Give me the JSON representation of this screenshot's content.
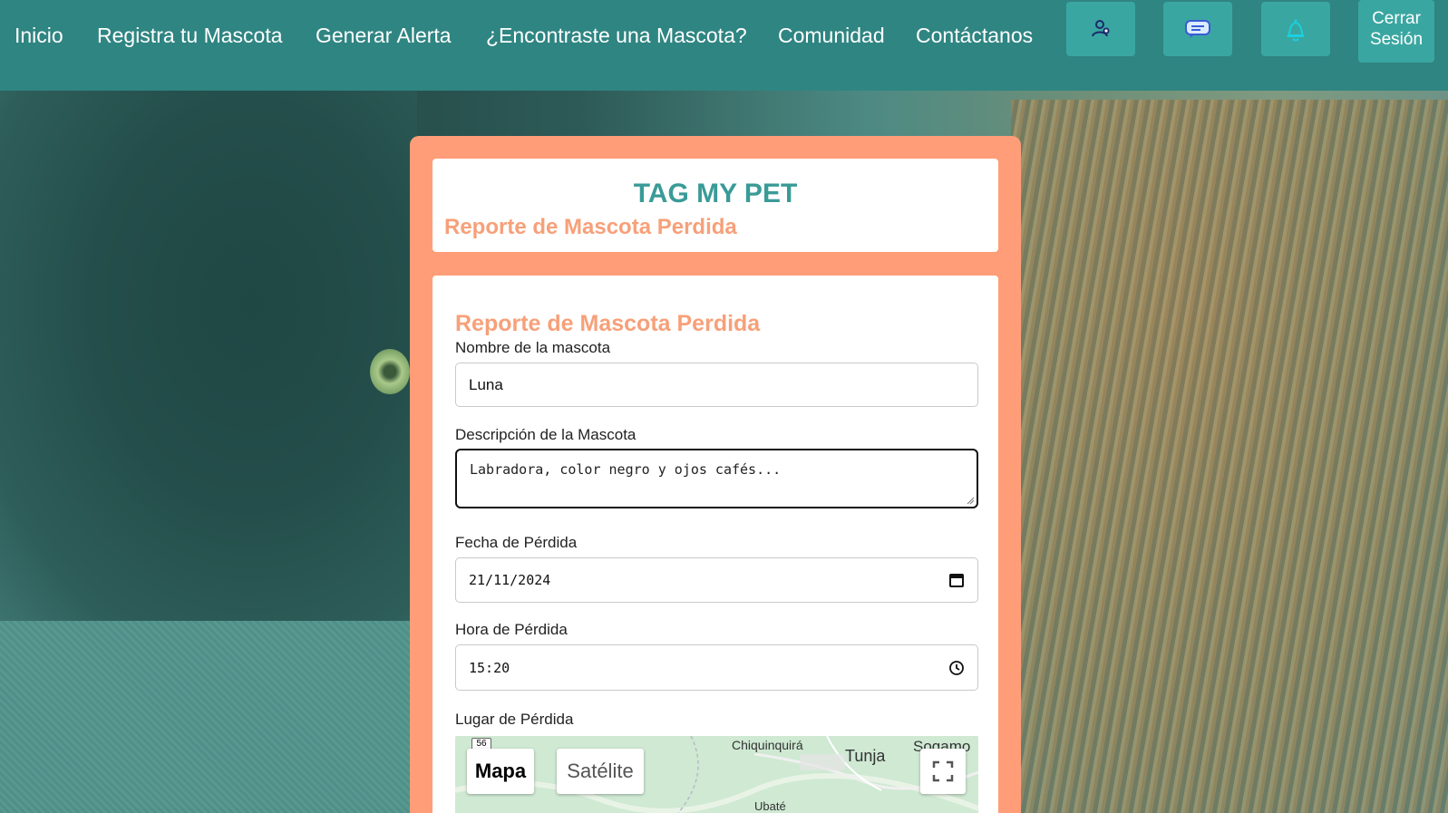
{
  "nav": {
    "links": [
      "Inicio",
      "Registra tu Mascota",
      "Generar Alerta",
      "¿Encontraste una Mascota?",
      "Comunidad",
      "Contáctanos"
    ],
    "icons": [
      "users-icon",
      "chat-icon",
      "bell-icon"
    ],
    "logout_line1": "Cerrar",
    "logout_line2": "Sesión"
  },
  "header": {
    "title": "TAG MY PET",
    "subtitle": "Reporte de Mascota Perdida"
  },
  "form": {
    "heading": "Reporte de Mascota Perdida",
    "name_label": "Nombre de la mascota",
    "name_value": "Luna",
    "description_label": "Descripción de la Mascota",
    "description_placeholder": "Labradora, color negro y ojos cafés...",
    "date_label": "Fecha de Pérdida",
    "date_value": "21/11/2024",
    "time_label": "Hora de Pérdida",
    "time_value": "15:20",
    "place_label": "Lugar de Pérdida"
  },
  "map": {
    "type_map": "Mapa",
    "type_satellite": "Satélite",
    "places": [
      "Chiquinquirá",
      "Tunja",
      "Sogamo",
      "Ubaté"
    ],
    "road_marker": "56"
  },
  "colors": {
    "navbar": "#2f8582",
    "nav_button": "#3aa6a1",
    "card": "#ff9d78",
    "brand_teal": "#3a9b97",
    "accent_orange": "#f7a079"
  }
}
